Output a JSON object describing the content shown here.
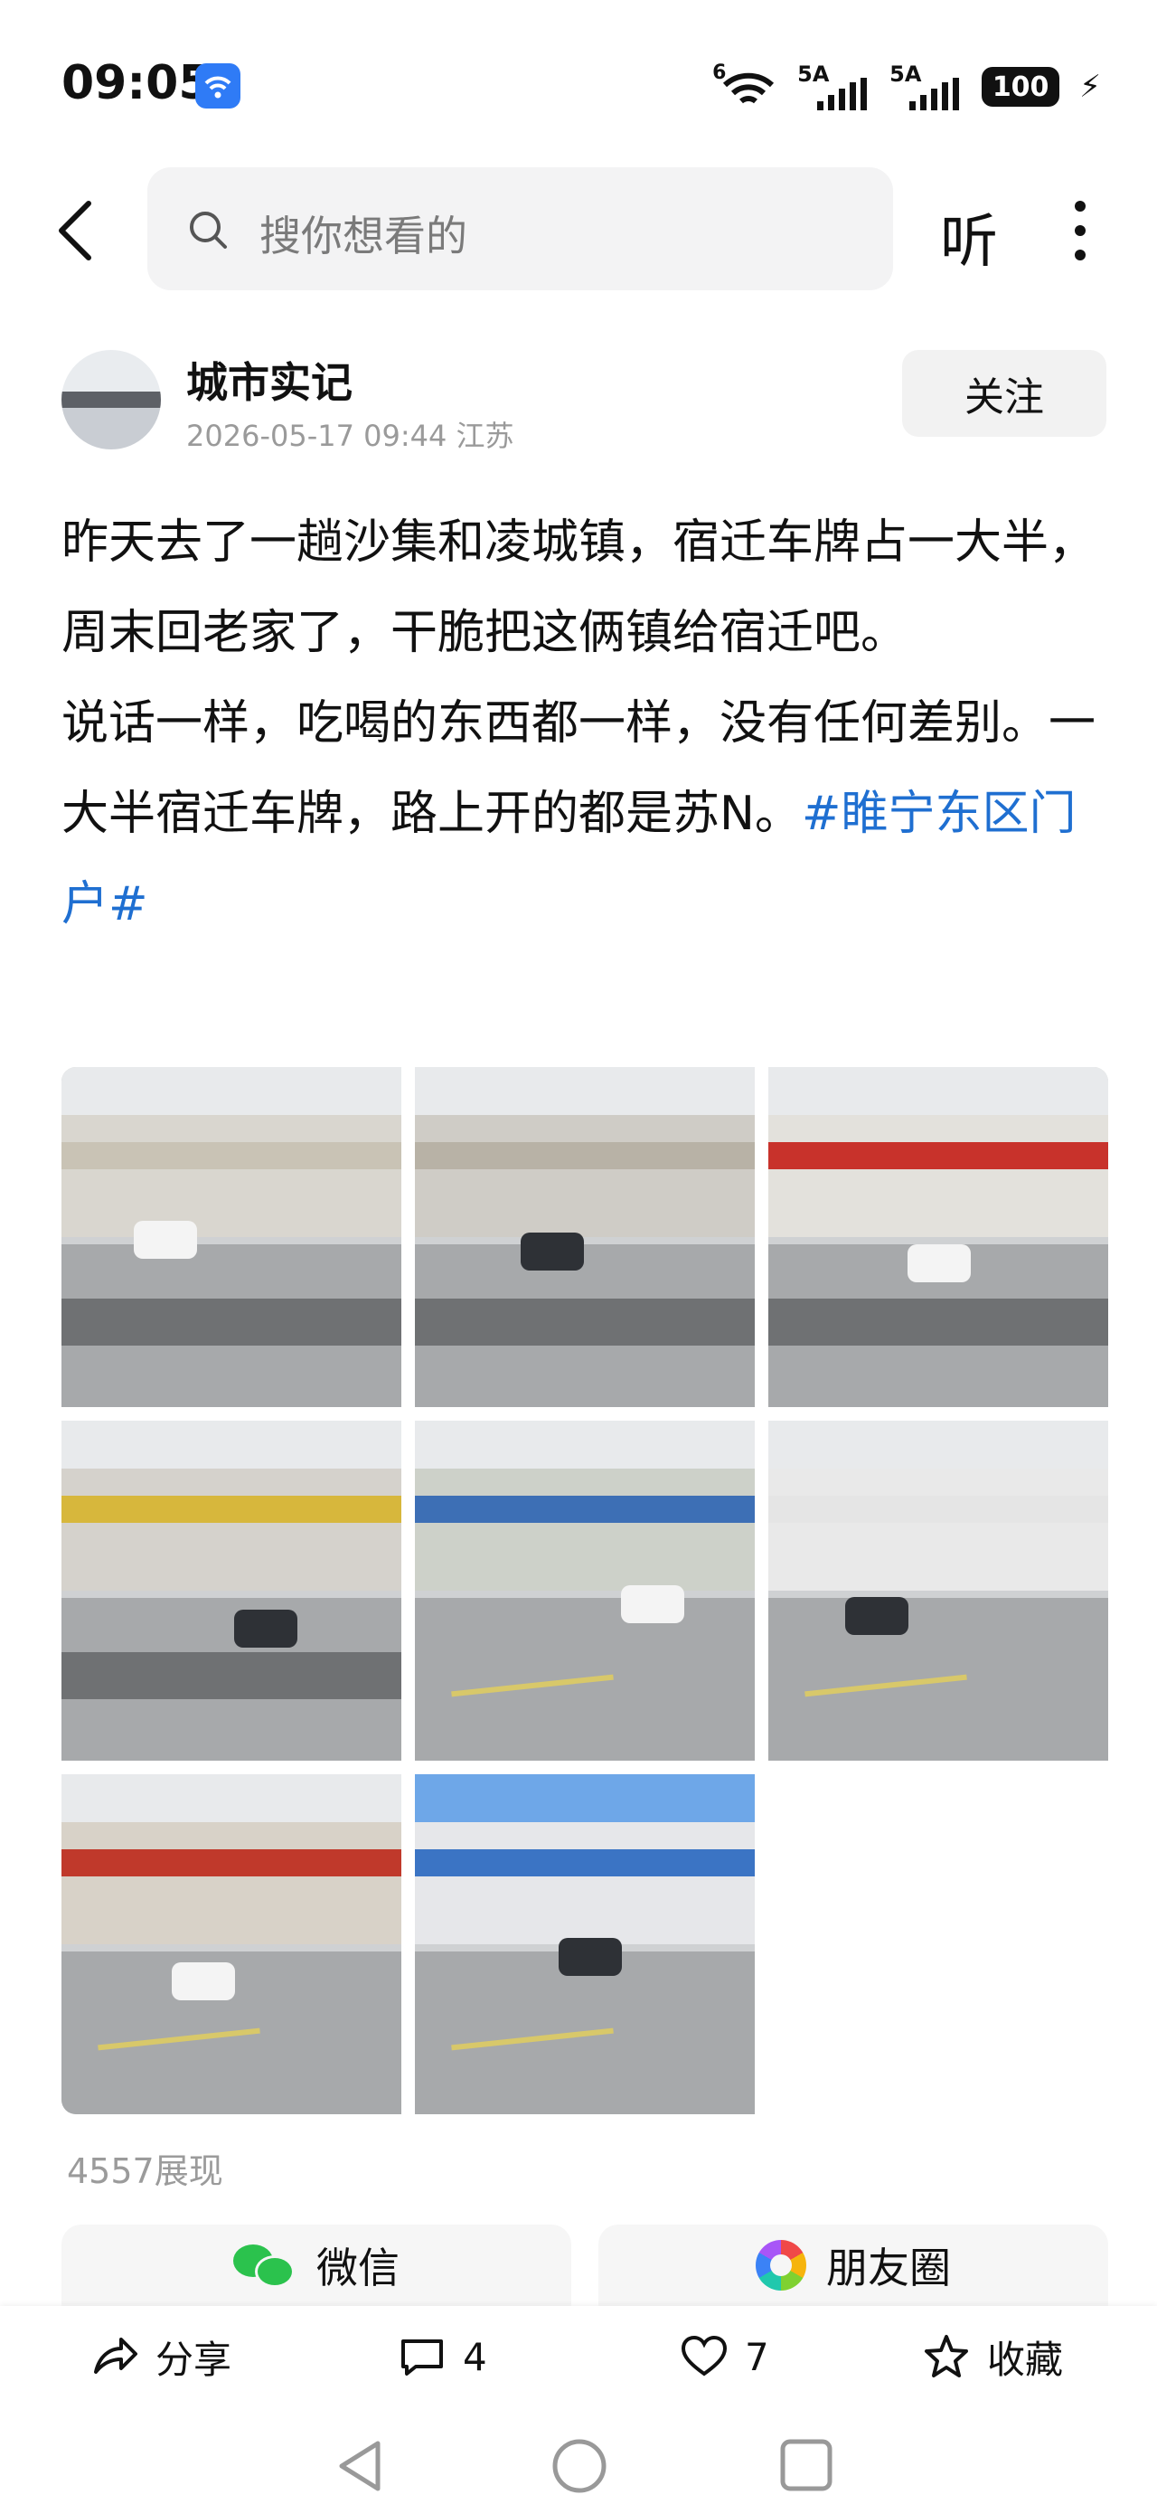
{
  "status_bar": {
    "time": "09:05",
    "signal1": "5A",
    "signal2": "5A",
    "battery": "100",
    "wifi_label": "6"
  },
  "header": {
    "search_placeholder": "搜你想看的",
    "listen_label": "听"
  },
  "author": {
    "name": "城市实记",
    "meta": "2026-05-17 09:44 江苏",
    "follow_label": "关注"
  },
  "post": {
    "para1": "昨天去了一趟沙集和凌城镇，宿迁车牌占一大半，周末回老家了，干脆把这俩镇给宿迁吧。",
    "para2": "说话一样，吃喝的东西都一样，没有任何差别。一大半宿迁车牌，路上开的都是苏N。",
    "hashtag": "#睢宁东区门户#"
  },
  "photos": [
    {
      "sign_color": "#c9c3b5",
      "building": "#d9d6cf"
    },
    {
      "sign_color": "#b8b2a6",
      "building": "#cfccc6"
    },
    {
      "sign_color": "#c8322b",
      "building": "#e3e1dc"
    },
    {
      "sign_color": "#d7b73c",
      "building": "#d5d2cc"
    },
    {
      "sign_color": "#3d6fb5",
      "building": "#cdd1c9"
    },
    {
      "sign_color": "#e5e5e5",
      "building": "#e9e9e9"
    },
    {
      "sign_color": "#c0392b",
      "building": "#d8d2c8"
    },
    {
      "sign_color": "#3b74c4",
      "building": "#e6e7ea"
    }
  ],
  "views": "4557展现",
  "share": {
    "wechat": "微信",
    "moments": "朋友圈"
  },
  "actions": {
    "share": "分享",
    "comments": "4",
    "likes": "7",
    "favorite": "收藏"
  },
  "colors": {
    "accent": "#1f6fd1",
    "wechat": "#2bc24d"
  }
}
